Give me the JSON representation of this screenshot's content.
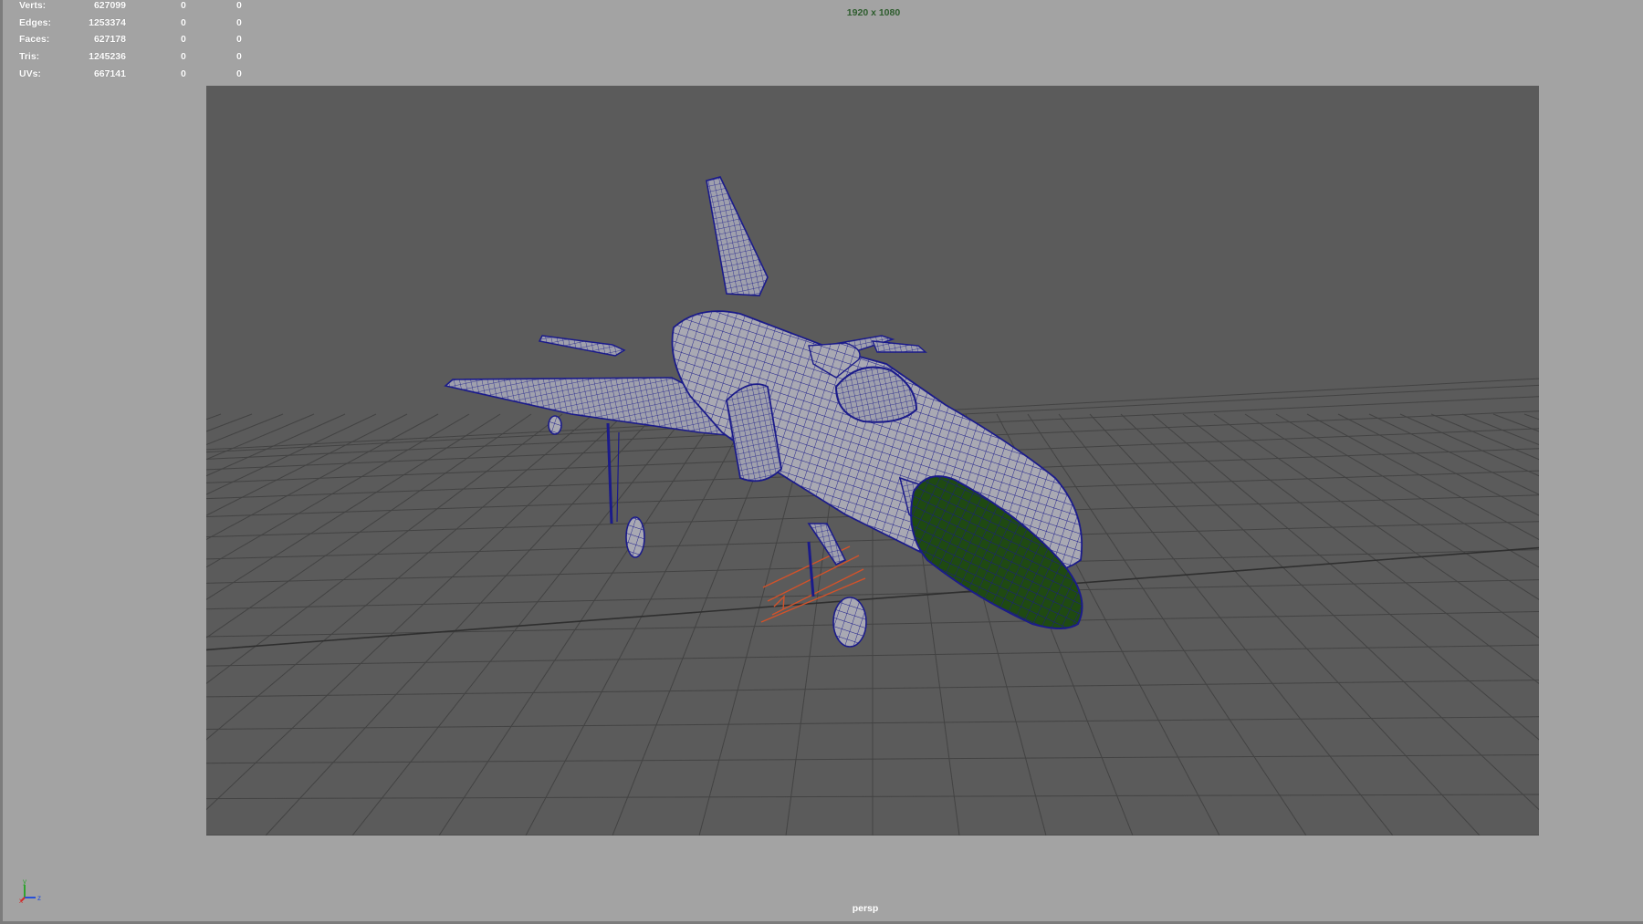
{
  "hud": {
    "rows": [
      {
        "label": "Verts:",
        "total": "627099",
        "selected": "0",
        "component": "0"
      },
      {
        "label": "Edges:",
        "total": "1253374",
        "selected": "0",
        "component": "0"
      },
      {
        "label": "Faces:",
        "total": "627178",
        "selected": "0",
        "component": "0"
      },
      {
        "label": "Tris:",
        "total": "1245236",
        "selected": "0",
        "component": "0"
      },
      {
        "label": "UVs:",
        "total": "667141",
        "selected": "0",
        "component": "0"
      }
    ]
  },
  "viewport": {
    "resolution_gate": "1920 x 1080",
    "camera": "persp",
    "background_color": "#a3a3a3",
    "render_region_color": "#5b5b5b",
    "grid_color": "#3f3f3f",
    "wireframe_color": "#1b1b8a",
    "surface_color": "#aaaaaa",
    "selected_surface_color": "#1f4a12",
    "light_gizmo_color": "#d2522a"
  },
  "axis_gizmo": {
    "x_label": "x",
    "y_label": "y",
    "z_label": "z",
    "icon": "axis-triad-icon"
  }
}
